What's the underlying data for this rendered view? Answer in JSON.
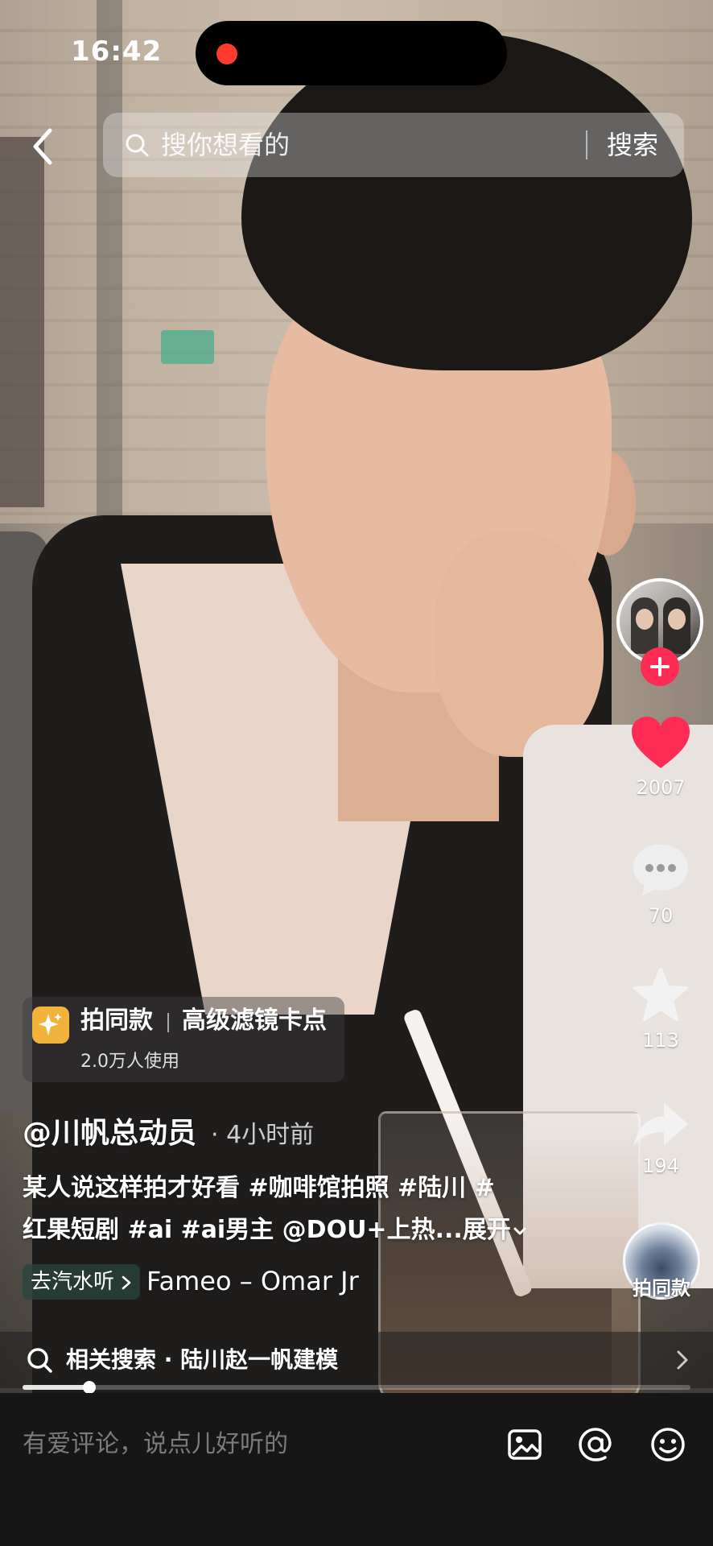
{
  "status": {
    "time": "16:42"
  },
  "search": {
    "placeholder": "搜你想看的",
    "button": "搜索"
  },
  "effect": {
    "name": "拍同款",
    "desc": "高级滤镜卡点",
    "users": "2.0万人使用"
  },
  "post": {
    "author": "@川帆总动员",
    "time": "· 4小时前",
    "caption_line1": "某人说这样拍才好看 #咖啡馆拍照 #陆川 #",
    "caption_line2": "红果短剧 #ai #ai男主 @DOU+上热...",
    "expand": "展开"
  },
  "music": {
    "tag": "去汽水听",
    "name": "Fameo – Omar Jr"
  },
  "rail": {
    "likes": "2007",
    "comments": "70",
    "favorites": "113",
    "shares": "194",
    "sound_label": "拍同款"
  },
  "related": {
    "text": "相关搜索 · 陆川赵一帆建模"
  },
  "progress": {
    "fraction": 0.1
  },
  "comment": {
    "placeholder": "有爱评论，说点儿好听的"
  },
  "colors": {
    "like": "#fe2c55",
    "follow": "#fe2c55",
    "record_dot": "#ff3b30",
    "effect_icon": "#f2b33d"
  },
  "icons": [
    "back-chevron-icon",
    "search-icon",
    "plus-icon",
    "heart-icon",
    "comment-icon",
    "star-icon",
    "share-icon",
    "image-icon",
    "at-icon",
    "emoji-icon",
    "chevron-right-icon"
  ]
}
